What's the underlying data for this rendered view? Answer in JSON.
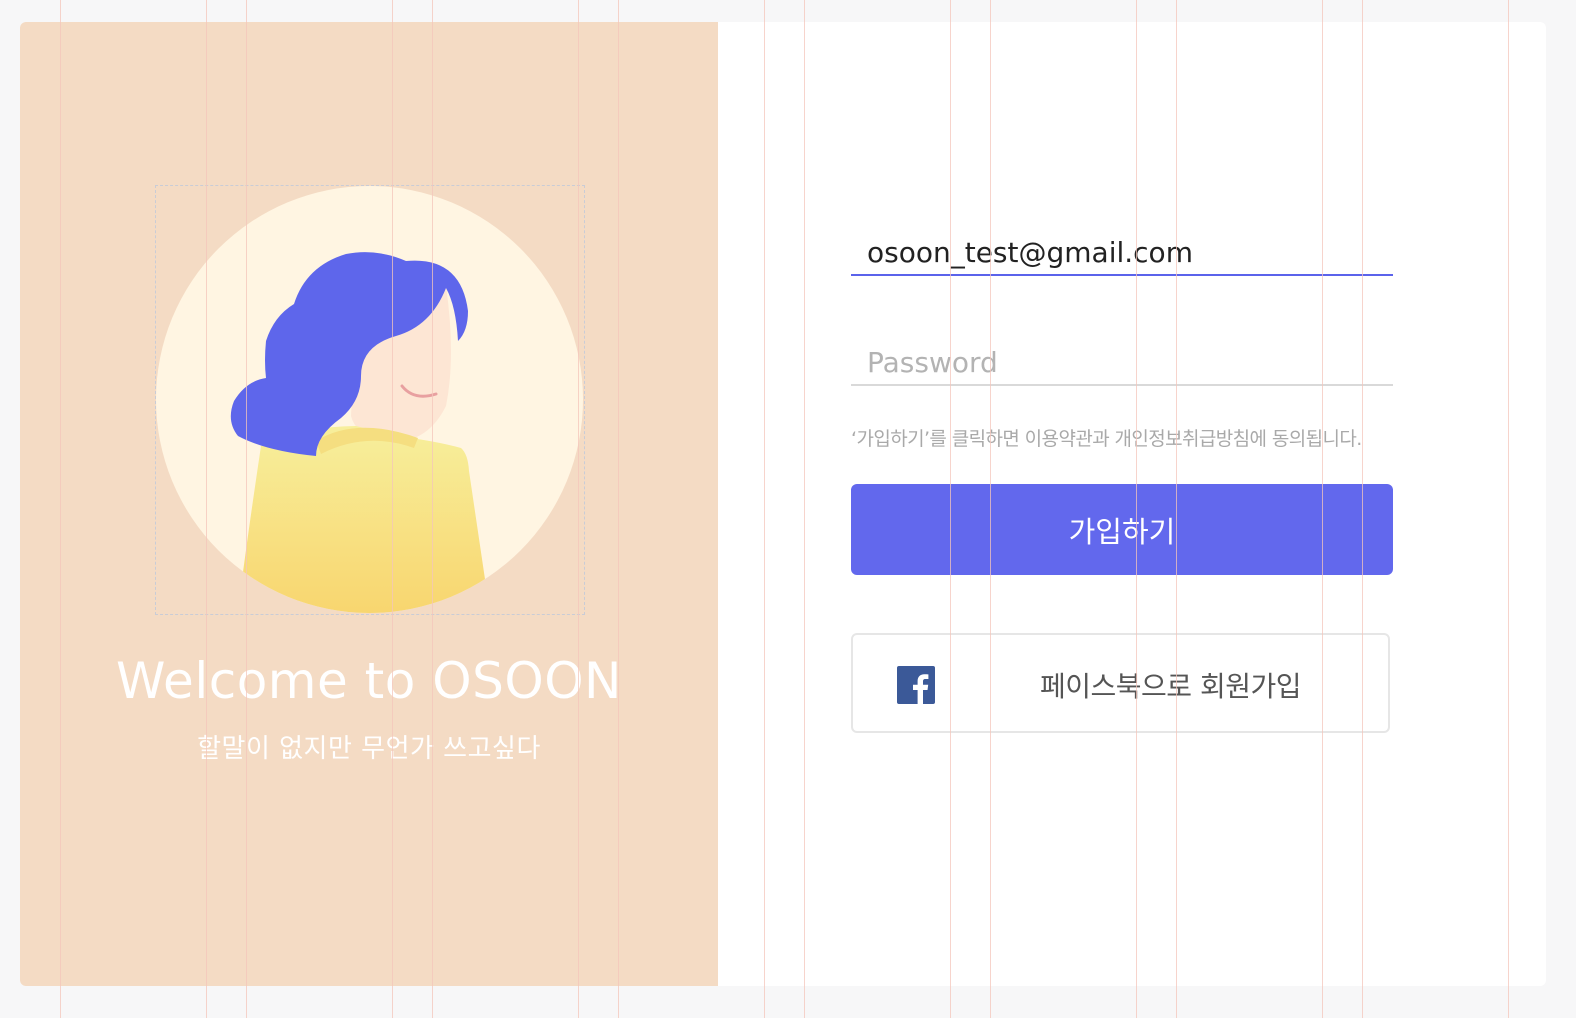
{
  "welcome": {
    "title": "Welcome to OSOON",
    "subtitle": "할말이 없지만 무언가 쓰고싶다"
  },
  "avatar": {
    "icon": "woman-avatar-icon",
    "colors": {
      "panel_background": "#f4dbc4",
      "circle": "#fff5e2",
      "hair": "#5e66eb",
      "skin": "#fde6d4",
      "smile": "#e8a0a0",
      "shirt_top": "#f7ef9c",
      "shirt_bottom": "#f8d46c"
    }
  },
  "form": {
    "email_value": "osoon_test@gmail.com",
    "password_placeholder": "Password",
    "terms_notice": "‘가입하기’를 클릭하면 이용약관과 개인정보취급방침에 동의됩니다.",
    "signup_label": "가입하기",
    "facebook_label": "페이스북으로 회원가입",
    "facebook_icon": "facebook-icon"
  },
  "colors": {
    "accent": "#6268ed",
    "input_active_border": "#5b63eb",
    "input_border": "#d9d9d9",
    "notice_text": "#a9a9a9",
    "facebook_blue": "#3b5998",
    "grid_line": "#f5c6bb"
  }
}
